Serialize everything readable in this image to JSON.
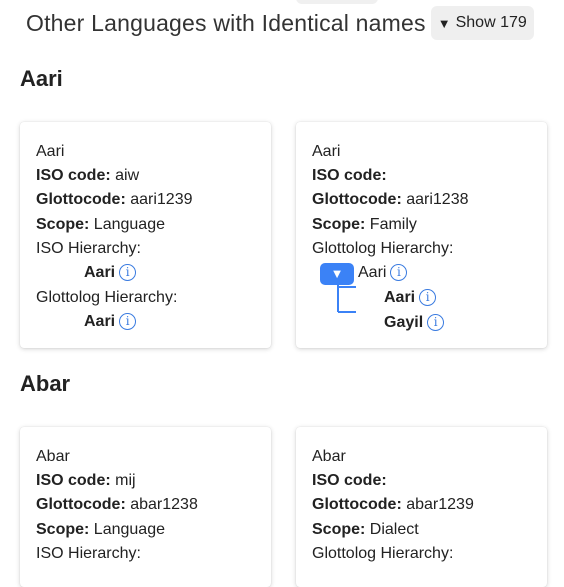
{
  "header": {
    "title": "Other Languages with Identical names",
    "show_label": "Show 179",
    "show_icon": "triangle-down-icon"
  },
  "accent": "#3b82f6",
  "labels": {
    "iso_code": "ISO code:",
    "glottocode": "Glottocode:",
    "scope": "Scope:",
    "iso_hierarchy": "ISO Hierarchy:",
    "glottolog_hierarchy": "Glottolog Hierarchy:",
    "info_symbol": "i"
  },
  "groups": [
    {
      "title": "Aari",
      "cards": [
        {
          "name": "Aari",
          "iso_code": "aiw",
          "glottocode": "aari1239",
          "scope": "Language",
          "iso_hierarchy": [
            "Aari"
          ],
          "glottolog_hierarchy": [
            "Aari"
          ]
        },
        {
          "name": "Aari",
          "iso_code": "",
          "glottocode": "aari1238",
          "scope": "Family",
          "glottolog_root": "Aari",
          "glottolog_children": [
            "Aari",
            "Gayil"
          ]
        }
      ]
    },
    {
      "title": "Abar",
      "cards": [
        {
          "name": "Abar",
          "iso_code": "mij",
          "glottocode": "abar1238",
          "scope": "Language"
        },
        {
          "name": "Abar",
          "iso_code": "",
          "glottocode": "abar1239",
          "scope": "Dialect"
        }
      ]
    }
  ]
}
